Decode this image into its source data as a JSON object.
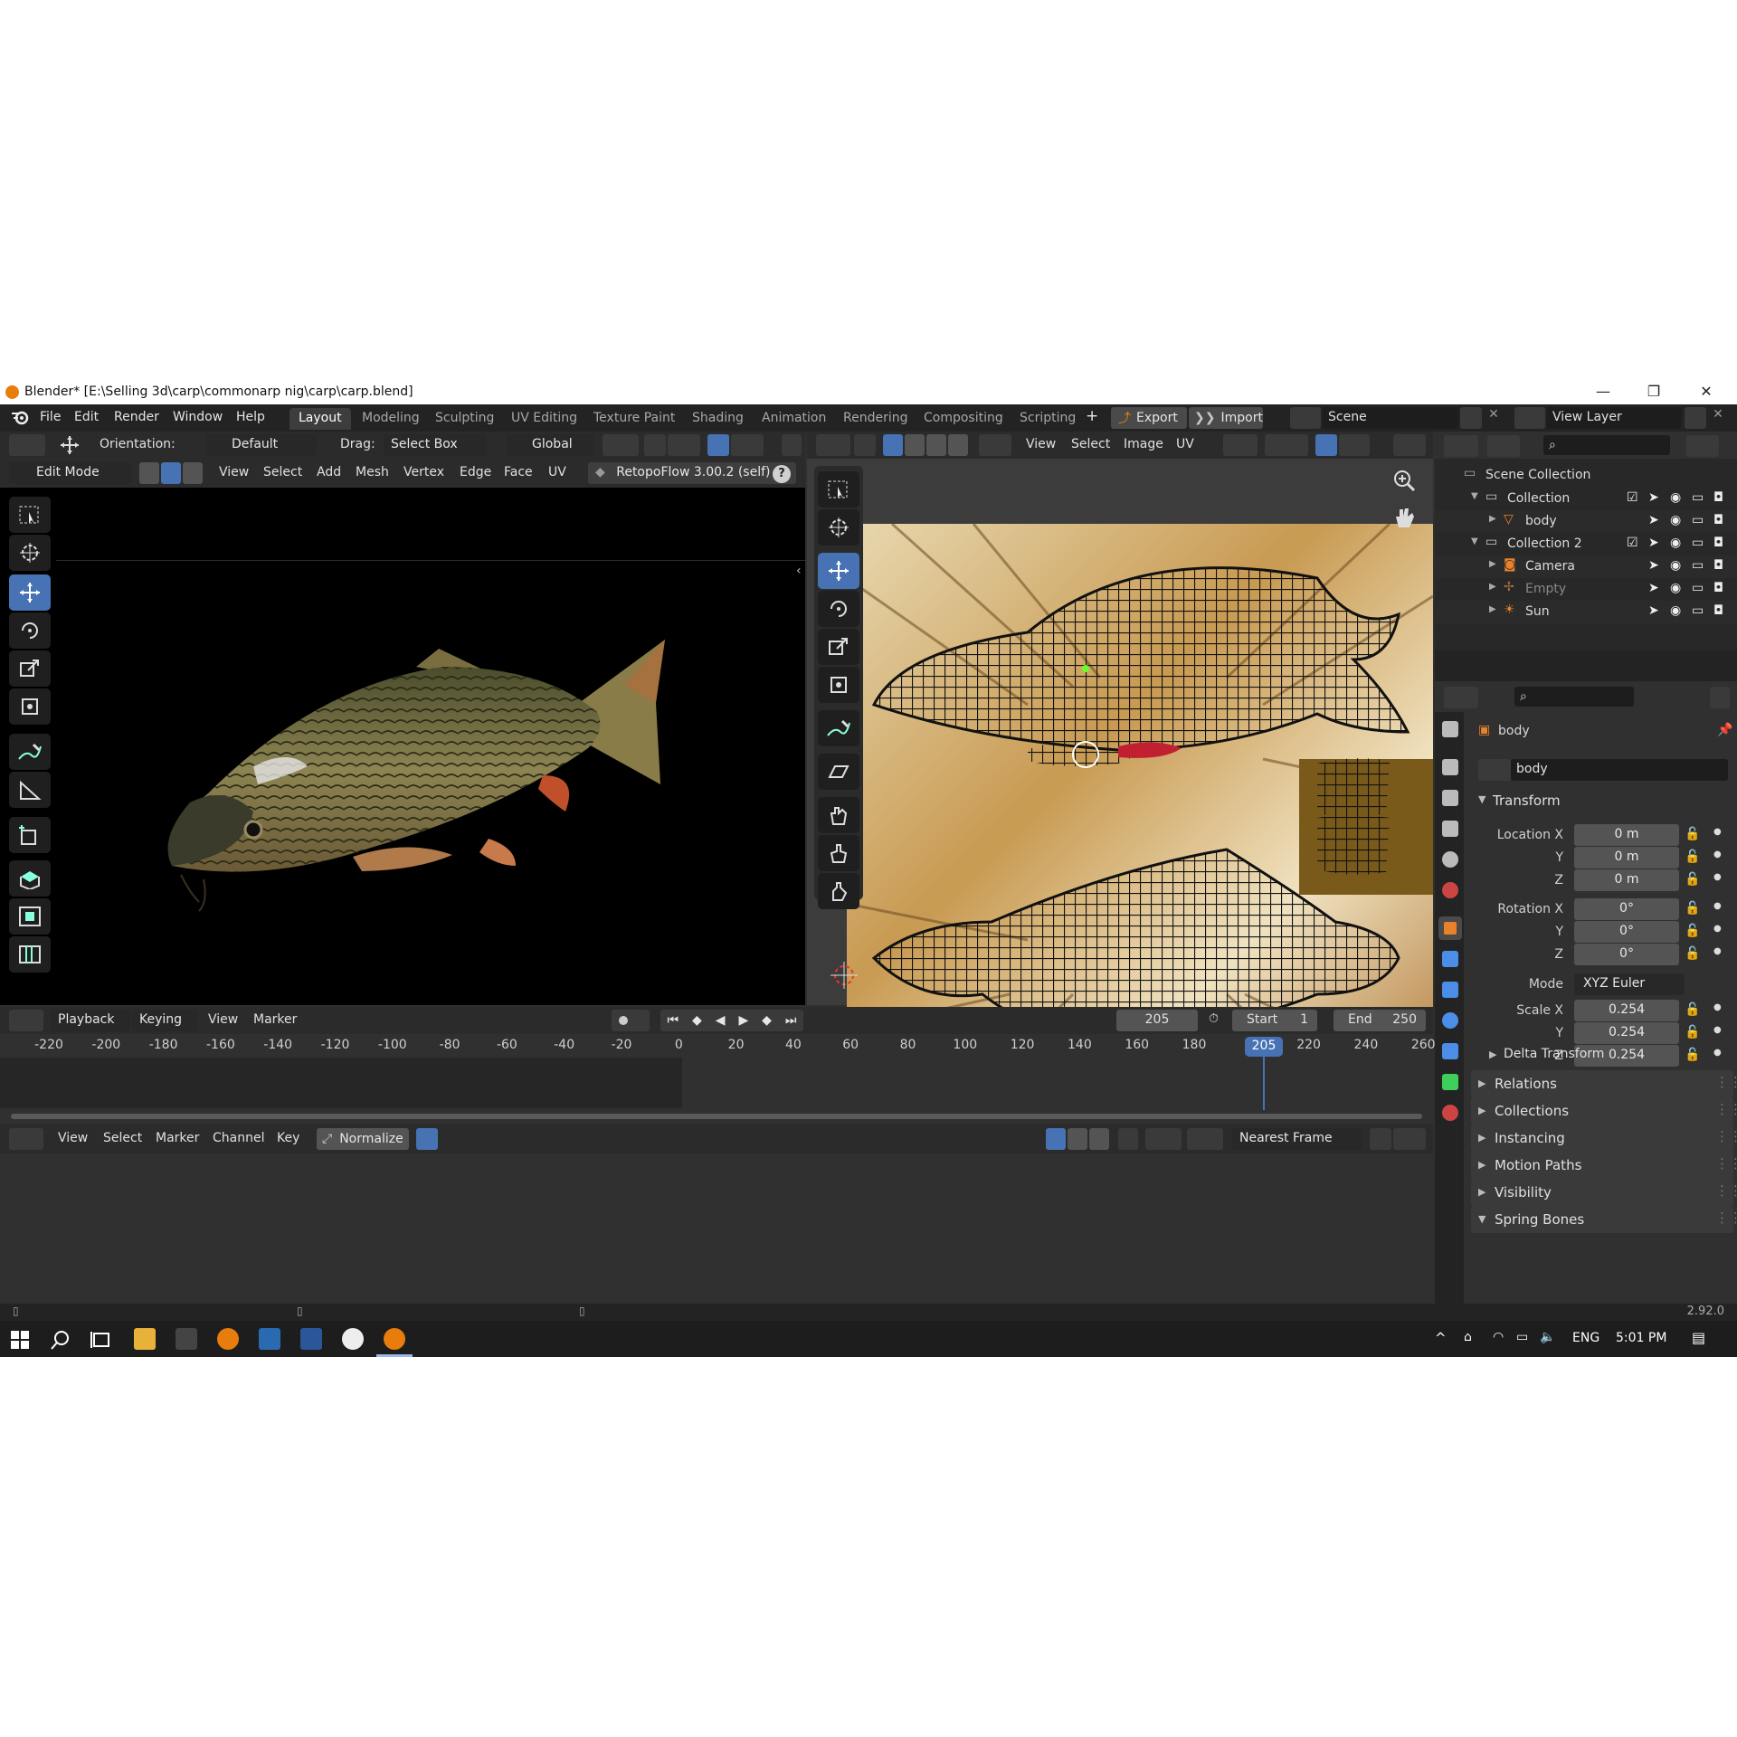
{
  "window": {
    "title": "Blender* [E:\\Selling 3d\\carp\\commonarp nig\\carp\\carp.blend]",
    "minimize": "—",
    "maximize": "❐",
    "close": "✕"
  },
  "menu": {
    "items": [
      "File",
      "Edit",
      "Render",
      "Window",
      "Help"
    ],
    "workspaces": [
      "Layout",
      "Modeling",
      "Sculpting",
      "UV Editing",
      "Texture Paint",
      "Shading",
      "Animation",
      "Rendering",
      "Compositing",
      "Scripting"
    ],
    "active_workspace": "Layout",
    "add_tab": "+",
    "export": "Export",
    "import": "Import",
    "scene": "Scene",
    "view_layer": "View Layer"
  },
  "viewport": {
    "orientation_label": "Orientation:",
    "orientation_value": "Default",
    "drag_label": "Drag:",
    "drag_value": "Select Box",
    "transform_space": "Global",
    "mode": "Edit Mode",
    "menus": [
      "View",
      "Select",
      "Add",
      "Mesh",
      "Vertex",
      "Edge",
      "Face",
      "UV"
    ],
    "addon": "RetopoFlow 3.00.2 (self)",
    "help": "?"
  },
  "uv_editor": {
    "menus": [
      "View",
      "Select",
      "Image",
      "UV"
    ]
  },
  "outliner": {
    "scene_collection": "Scene Collection",
    "rows": [
      {
        "name": "Collection",
        "indent": 1
      },
      {
        "name": "body",
        "indent": 2
      },
      {
        "name": "Collection 2",
        "indent": 1
      },
      {
        "name": "Camera",
        "indent": 2
      },
      {
        "name": "Empty",
        "indent": 2
      },
      {
        "name": "Sun",
        "indent": 2
      }
    ]
  },
  "properties": {
    "object_name": "body",
    "data_name": "body",
    "transform_title": "Transform",
    "location_x_label": "Location X",
    "rotation_x_label": "Rotation X",
    "scale_x_label": "Scale X",
    "y_label": "Y",
    "z_label": "Z",
    "mode_label": "Mode",
    "mode_value": "XYZ Euler",
    "location": [
      "0 m",
      "0 m",
      "0 m"
    ],
    "rotation": [
      "0°",
      "0°",
      "0°"
    ],
    "scale": [
      "0.254",
      "0.254",
      "0.254"
    ],
    "delta_transform": "Delta Transform",
    "panels": [
      "Relations",
      "Collections",
      "Instancing",
      "Motion Paths",
      "Visibility",
      "Spring Bones"
    ]
  },
  "timeline": {
    "menus": [
      "Playback",
      "Keying",
      "View",
      "Marker"
    ],
    "current_frame": "205",
    "start_label": "Start",
    "start_value": "1",
    "end_label": "End",
    "end_value": "250",
    "ticks": [
      "-220",
      "-200",
      "-180",
      "-160",
      "-140",
      "-120",
      "-100",
      "-80",
      "-60",
      "-40",
      "-20",
      "0",
      "20",
      "40",
      "60",
      "80",
      "100",
      "120",
      "140",
      "160",
      "180",
      "2",
      "220",
      "240",
      "260"
    ],
    "playhead": "205"
  },
  "graph_editor": {
    "menus": [
      "View",
      "Select",
      "Marker",
      "Channel",
      "Key"
    ],
    "normalize": "Normalize",
    "interpolation": "Nearest Frame"
  },
  "status": {
    "version": "2.92.0"
  },
  "taskbar": {
    "language": "ENG",
    "time": "5:01 PM"
  },
  "colors": {
    "accent": "#4772b3",
    "orange": "#e87d0d",
    "bg": "#303030"
  }
}
